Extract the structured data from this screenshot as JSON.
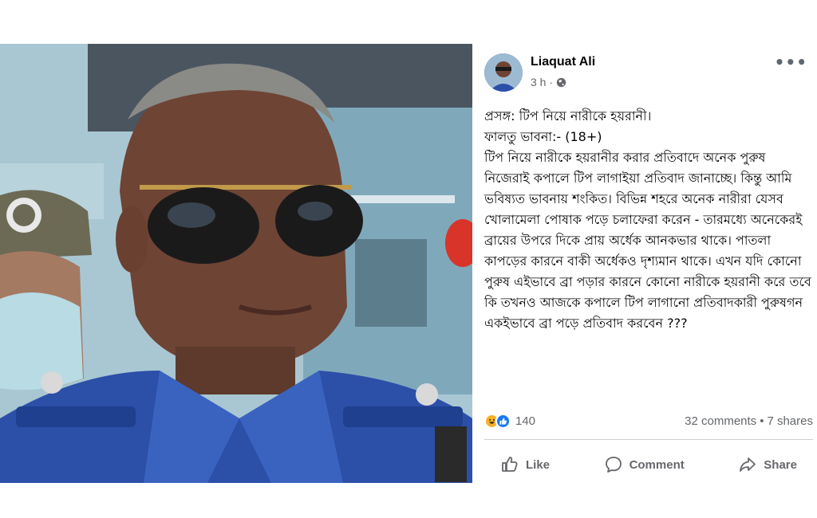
{
  "post": {
    "author": "Liaquat Ali",
    "time": "3 h ·",
    "more_label": "•••",
    "body_lines": [
      "প্রসঙ্গ: টিপ নিয়ে নারীকে হয়রানী।",
      "ফালতু ভাবনা:-  (18+)",
      " টিপ নিয়ে নারীকে হয়রানীর করার প্রতিবাদে অনেক পুরুষ নিজেরাই কপালে টিপ লাগাইয়া প্রতিবাদ জানাচ্ছে। কিন্তু আমি ভবিষ্যত ভাবনায় শংকিত। বিভিন্ন শহরে অনেক নারীরা যেসব খোলামেলা পোষাক পড়ে চলাফেরা করেন - তারমধ্যে অনেকেরই ব্রায়ের উপরে দিকে প্রায় অর্ধেক আনকভার থাকে। পাতলা কাপড়ের কারনে বাকী অর্ধেকও দৃশ্যমান থাকে। এখন যদি কোনো পুরুষ এইভাবে ব্রা পড়ার কারনে কোনো নারীকে হয়রানী করে তবে কি তখনও আজকে কপালে টিপ লাগানো প্রতিবাদকারী পুরুষগন একইভাবে ব্রা পড়ে প্রতিবাদ করবেন ???"
    ],
    "reactions": {
      "count": "140",
      "icons": [
        "haha-reaction-icon",
        "like-reaction-icon"
      ],
      "comments": "32 comments",
      "separator": "•",
      "shares": "7 shares"
    },
    "actions": {
      "like": "Like",
      "comment": "Comment",
      "share": "Share"
    }
  },
  "colors": {
    "accent": "#1877f2",
    "secondary_text": "#65676b",
    "divider": "#ced0d4"
  }
}
